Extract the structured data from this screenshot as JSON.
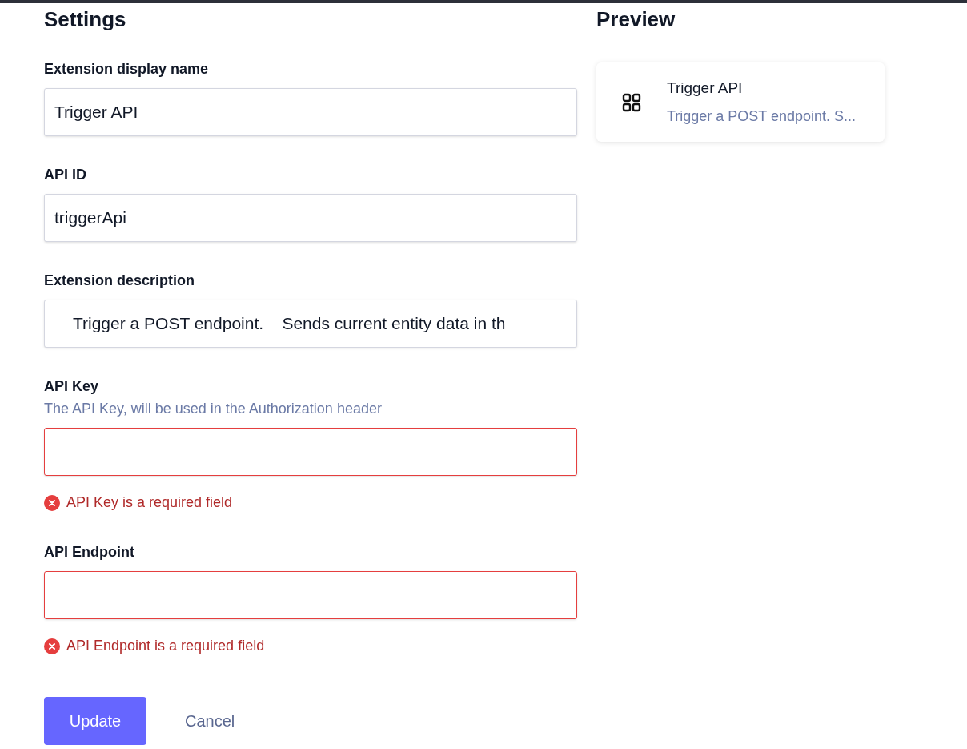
{
  "settings": {
    "title": "Settings",
    "fields": [
      {
        "label": "Extension display name",
        "value": "Trigger API",
        "invalid": false
      },
      {
        "label": "API ID",
        "value": "triggerApi",
        "invalid": false
      },
      {
        "label": "Extension description",
        "value": "    Trigger a POST endpoint.    Sends current entity data in th",
        "invalid": false
      },
      {
        "label": "API Key",
        "hint": "The API Key, will be used in the Authorization header",
        "invalid": true,
        "error": "API Key is a required field"
      },
      {
        "label": "API Endpoint",
        "invalid": true,
        "error": "API Endpoint is a required field"
      }
    ],
    "buttons": {
      "primary": "Update",
      "secondary": "Cancel"
    }
  },
  "preview": {
    "title": "Preview",
    "card": {
      "title": "Trigger API",
      "description": "Trigger a POST endpoint. S..."
    }
  }
}
